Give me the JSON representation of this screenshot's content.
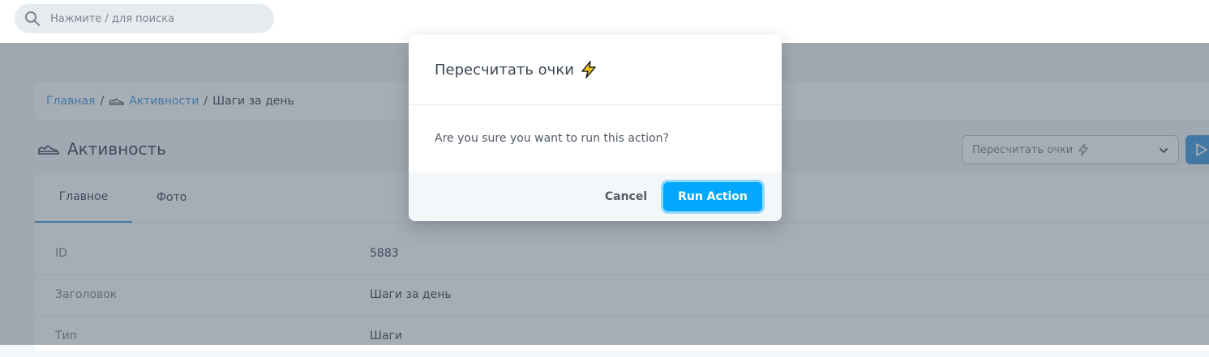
{
  "header": {
    "search": {
      "placeholder": "Нажмите / для поиска",
      "value": "",
      "icon": "search-icon"
    }
  },
  "breadcrumb": {
    "home": "Главная",
    "separator": "/",
    "section": "Активности",
    "section_icon": "shoe-icon",
    "current": "Шаги за день"
  },
  "page": {
    "title": "Активность",
    "title_icon": "shoe-icon",
    "action_select": {
      "selected": "Пересчитать очки",
      "icon": "lightning-icon"
    },
    "run_button_icon": "play-icon"
  },
  "tabs": [
    {
      "label": "Главное",
      "active": true
    },
    {
      "label": "Фото",
      "active": false
    }
  ],
  "fields": [
    {
      "label": "ID",
      "value": "5883"
    },
    {
      "label": "Заголовок",
      "value": "Шаги за день"
    },
    {
      "label": "Тип",
      "value": "Шаги"
    }
  ],
  "modal": {
    "title": "Пересчитать очки",
    "title_icon": "lightning-icon",
    "message": "Are you sure you want to run this action?",
    "cancel_label": "Cancel",
    "confirm_label": "Run Action"
  },
  "colors": {
    "primary": "#4099de",
    "confirm_button": "#01a8fe",
    "lightning": "#f5c518",
    "text": "#3c4655",
    "muted_text": "#7c858e"
  }
}
